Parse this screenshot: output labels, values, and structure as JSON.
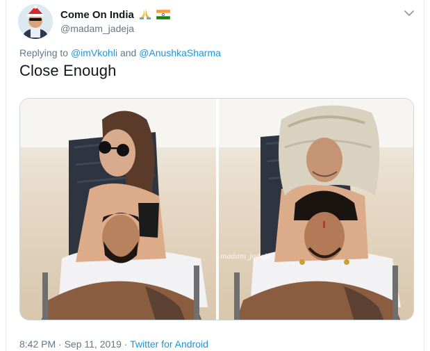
{
  "user": {
    "display_name": "Come On India",
    "handle": "@madam_jadeja",
    "emojis": [
      "folded-hands-icon",
      "india-flag-icon"
    ]
  },
  "tweet": {
    "replying_prefix": "Replying to",
    "reply_user_1": "@imVkohli",
    "reply_connector": "and",
    "reply_user_2": "@AnushkaSharma",
    "text": "Close Enough",
    "media_watermark": "madam_jadeja"
  },
  "meta": {
    "time": "8:42 PM",
    "separator_1": "·",
    "date": "Sep 11, 2019",
    "separator_2": "·",
    "source": "Twitter for Android"
  },
  "colors": {
    "link": "#1b95e0",
    "secondary_text": "#657786",
    "border": "#e6ecf0"
  }
}
